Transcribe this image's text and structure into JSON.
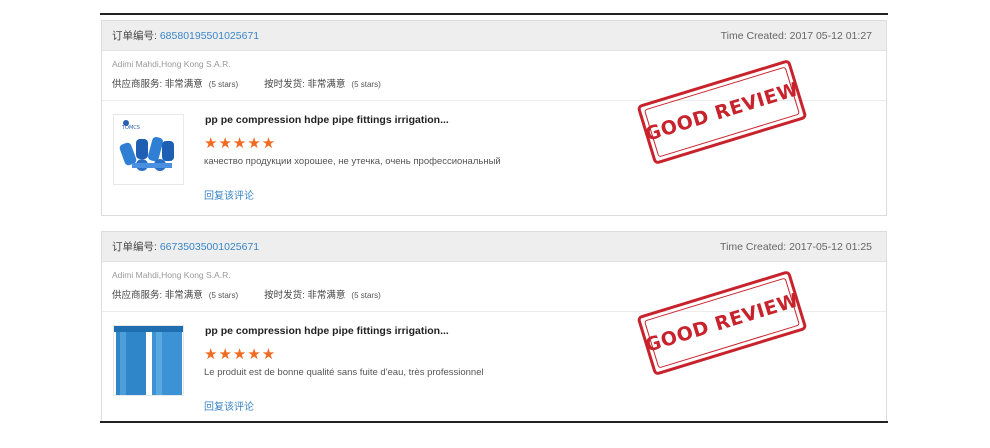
{
  "orders": [
    {
      "order_label": "订单编号:",
      "order_number": "68580195501025671",
      "time_created": "Time Created: 2017 05-12 01:27",
      "buyer": "Adimi Mahdi,Hong Kong S.A.R.",
      "supplier_service_label": "供应商服务: 非常满意",
      "supplier_service_stars": "(5 stars)",
      "ontime_label": "按时发货: 非常满意",
      "ontime_stars": "(5 stars)",
      "product_title": "pp pe compression hdpe pipe fittings irrigation...",
      "rating": "★★★★★",
      "review_text": "качество продукции хорошее, не утечка, очень профессиональный",
      "reply_link": "回复该评论",
      "stamp_text": "GOOD REVIEW",
      "thumb_brand": "TOMCS"
    },
    {
      "order_label": "订单编号:",
      "order_number": "66735035001025671",
      "time_created": "Time Created: 2017-05-12 01:25",
      "buyer": "Adimi Mahdi,Hong Kong S.A.R.",
      "supplier_service_label": "供应商服务: 非常满意",
      "supplier_service_stars": "(5 stars)",
      "ontime_label": "按时发货: 非常满意",
      "ontime_stars": "(5 stars)",
      "product_title": "pp pe compression hdpe pipe fittings irrigation...",
      "rating": "★★★★★",
      "review_text": "Le produit est de bonne qualité sans fuite d'eau, très professionnel",
      "reply_link": "回复该评论",
      "stamp_text": "GOOD REVIEW"
    }
  ],
  "colors": {
    "link": "#3a86c8",
    "star": "#f26a21",
    "stamp": "#c8232c"
  }
}
